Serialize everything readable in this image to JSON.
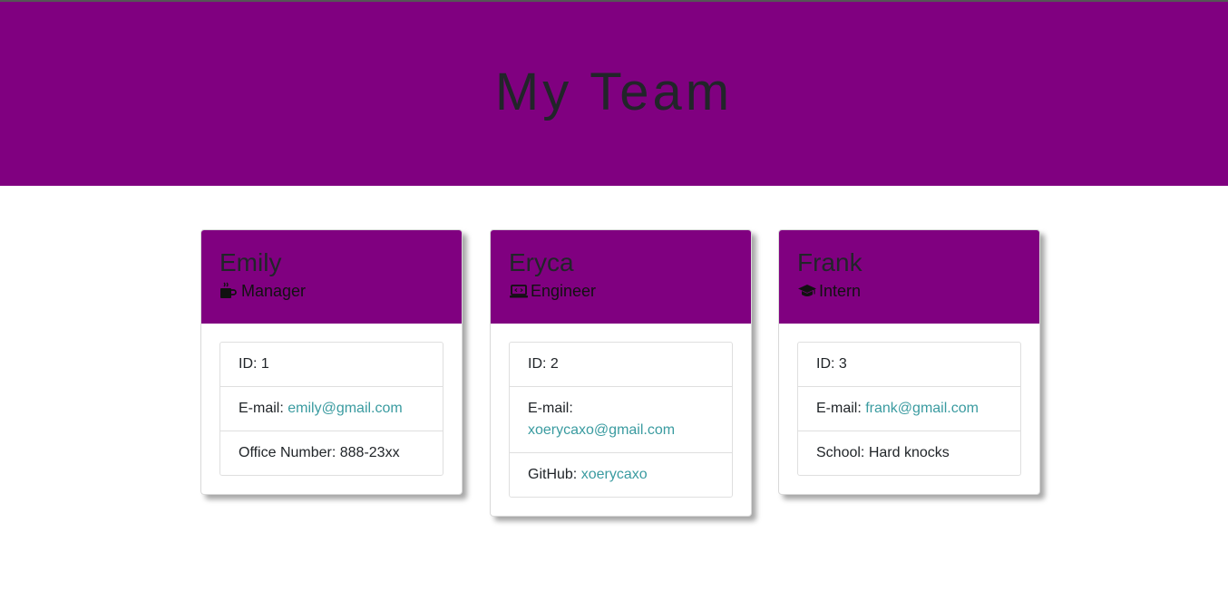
{
  "header": {
    "title": "My Team"
  },
  "colors": {
    "brand": "#800080",
    "link": "#3a9ba0"
  },
  "cards": [
    {
      "name": "Emily",
      "role": "Manager",
      "icon": "mug-icon",
      "id": "ID: 1",
      "email_label": "E-mail: ",
      "email": "emily@gmail.com",
      "extra_label": "Office Number: ",
      "extra_value": "888-23xx"
    },
    {
      "name": "Eryca",
      "role": "Engineer",
      "icon": "laptop-icon",
      "id": "ID: 2",
      "email_label": "E-mail: ",
      "email": "xoerycaxo@gmail.com",
      "extra_label": "GitHub: ",
      "extra_value": "xoerycaxo"
    },
    {
      "name": "Frank",
      "role": "Intern",
      "icon": "graduation-cap-icon",
      "id": "ID: 3",
      "email_label": "E-mail: ",
      "email": "frank@gmail.com",
      "extra_label": "School: ",
      "extra_value": "Hard knocks"
    }
  ]
}
